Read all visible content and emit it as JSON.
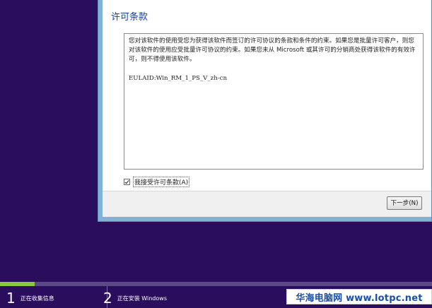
{
  "dialog": {
    "title": "许可条款",
    "license_text": "您对该软件的使用受您为获得该软件而签订的许可协议的条款和条件的约束。如果您是批量许可客户，则您对该软件的使用应受批量许可协议的约束。如果您未从 Microsoft 或其许可的分销商处获得该软件的有效许可，则不得使用该软件。",
    "eula_id": "EULAID:Win_RM_1_PS_V_zh-cn",
    "accept_checkbox": {
      "label": "我接受许可条款(A)",
      "checked": true
    },
    "next_button_label": "下一步(N)"
  },
  "progress": {
    "fraction": 0.08,
    "fill_color": "#8ec63f",
    "steps": [
      {
        "number": "1",
        "label": "正在收集信息"
      },
      {
        "number": "2",
        "label": "正在安装 Windows"
      }
    ]
  },
  "watermark": {
    "text": "华海电脑网 www.lotpc.net"
  }
}
